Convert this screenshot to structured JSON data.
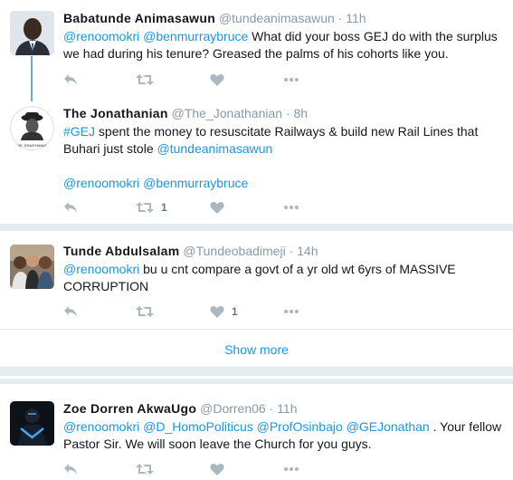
{
  "tweets": [
    {
      "name": "Babatunde Animasawun",
      "handle": "@tundeanimasawun",
      "sep": "·",
      "time": "11h",
      "lines": [
        [
          {
            "t": "@renoomokri",
            "link": true
          },
          {
            "t": " "
          },
          {
            "t": "@benmurraybruce",
            "link": true
          },
          {
            "t": " What did your boss GEJ do with the surplus"
          }
        ],
        [
          {
            "t": "we had during his tenure? Greased the palms of his cohorts like you."
          }
        ]
      ],
      "retweets": "",
      "likes": ""
    },
    {
      "name": "The Jonathanian",
      "handle": "@The_Jonathanian",
      "sep": "·",
      "time": "8h",
      "avatar_caption": "THE JONATHANIAN",
      "lines": [
        [
          {
            "t": "#GEJ",
            "link": true
          },
          {
            "t": " spent the money to resuscitate Railways & build new Rail Lines that"
          }
        ],
        [
          {
            "t": "Buhari just stole "
          },
          {
            "t": "@tundeanimasawun",
            "link": true
          }
        ],
        [
          {
            "t": " "
          }
        ],
        [
          {
            "t": "@renoomokri",
            "link": true
          },
          {
            "t": " "
          },
          {
            "t": "@benmurraybruce",
            "link": true
          }
        ]
      ],
      "retweets": "1",
      "likes": ""
    },
    {
      "name": "Tunde Abdulsalam",
      "handle": "@Tundeobadimeji",
      "sep": "·",
      "time": "14h",
      "lines": [
        [
          {
            "t": "@renoomokri",
            "link": true
          },
          {
            "t": " bu u cnt compare a govt of a yr old wt 6yrs of MASSIVE"
          }
        ],
        [
          {
            "t": "CORRUPTION"
          }
        ]
      ],
      "retweets": "",
      "likes": "1"
    },
    {
      "name": "Zoe Dorren AkwaUgo",
      "handle": "@Dorren06",
      "sep": "·",
      "time": "11h",
      "lines": [
        [
          {
            "t": "@renoomokri",
            "link": true
          },
          {
            "t": " "
          },
          {
            "t": "@D_HomoPoliticus",
            "link": true
          },
          {
            "t": " "
          },
          {
            "t": "@ProfOsinbajo",
            "link": true
          },
          {
            "t": " "
          },
          {
            "t": "@GEJonathan",
            "link": true
          },
          {
            "t": " . Your fellow"
          }
        ],
        [
          {
            "t": "Pastor Sir. We will soon leave the Church for you guys."
          }
        ]
      ],
      "retweets": "",
      "likes": ""
    }
  ],
  "show_more": "Show more",
  "icons": {
    "reply": "reply-icon",
    "retweet": "retweet-icon",
    "like": "heart-icon",
    "more": "more-dots-icon"
  },
  "colors": {
    "link": "#1b95e0",
    "icon": "#aab8c2",
    "separator": "#e6ecf0",
    "thread": "#6fa9d6"
  }
}
